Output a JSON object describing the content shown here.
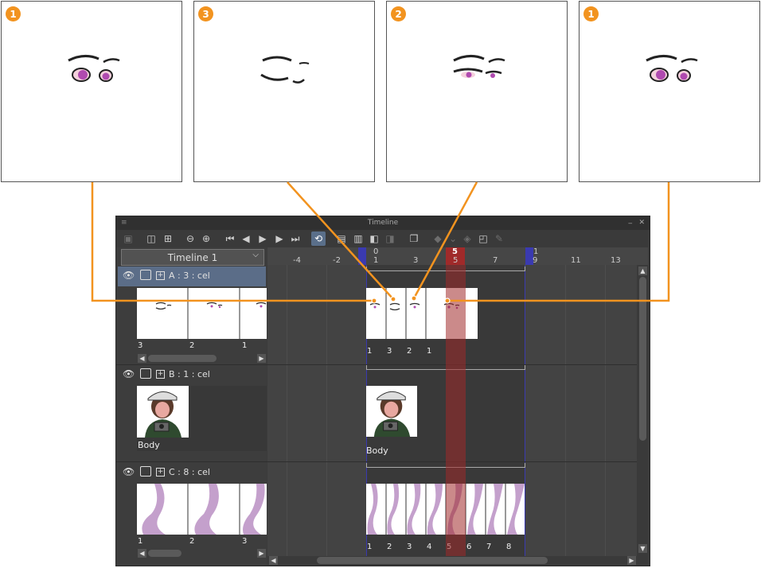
{
  "callouts": [
    {
      "badge": "1"
    },
    {
      "badge": "3"
    },
    {
      "badge": "2"
    },
    {
      "badge": "1"
    }
  ],
  "window": {
    "title": "Timeline",
    "minimize_glyph": "_",
    "close_glyph": "✕",
    "menu_glyph": "≡"
  },
  "timeline_select": {
    "value": "Timeline 1"
  },
  "ruler": {
    "top_labels": [
      "0",
      "5",
      "1"
    ],
    "numbers": [
      "-4",
      "-2",
      "1",
      "3",
      "5",
      "7",
      "9",
      "11",
      "13"
    ]
  },
  "layers": [
    {
      "name": "A : 3 : cel",
      "panel_frames": [
        "3",
        "2",
        "1"
      ],
      "track_frames": [
        "1",
        "3",
        "2",
        "1"
      ]
    },
    {
      "name": "B : 1 : cel",
      "panel_frames": [
        "Body"
      ],
      "track_frames": [
        "Body"
      ]
    },
    {
      "name": "C : 8 : cel",
      "panel_frames": [
        "1",
        "2",
        "3"
      ],
      "track_frames": [
        "1",
        "2",
        "3",
        "4",
        "5",
        "6",
        "7",
        "8"
      ]
    }
  ],
  "colors": {
    "accent_orange": "#f2931f",
    "playhead_red": "#a02a2a",
    "range_blue": "#3a3ab0",
    "selected_layer": "#5b6d88"
  }
}
